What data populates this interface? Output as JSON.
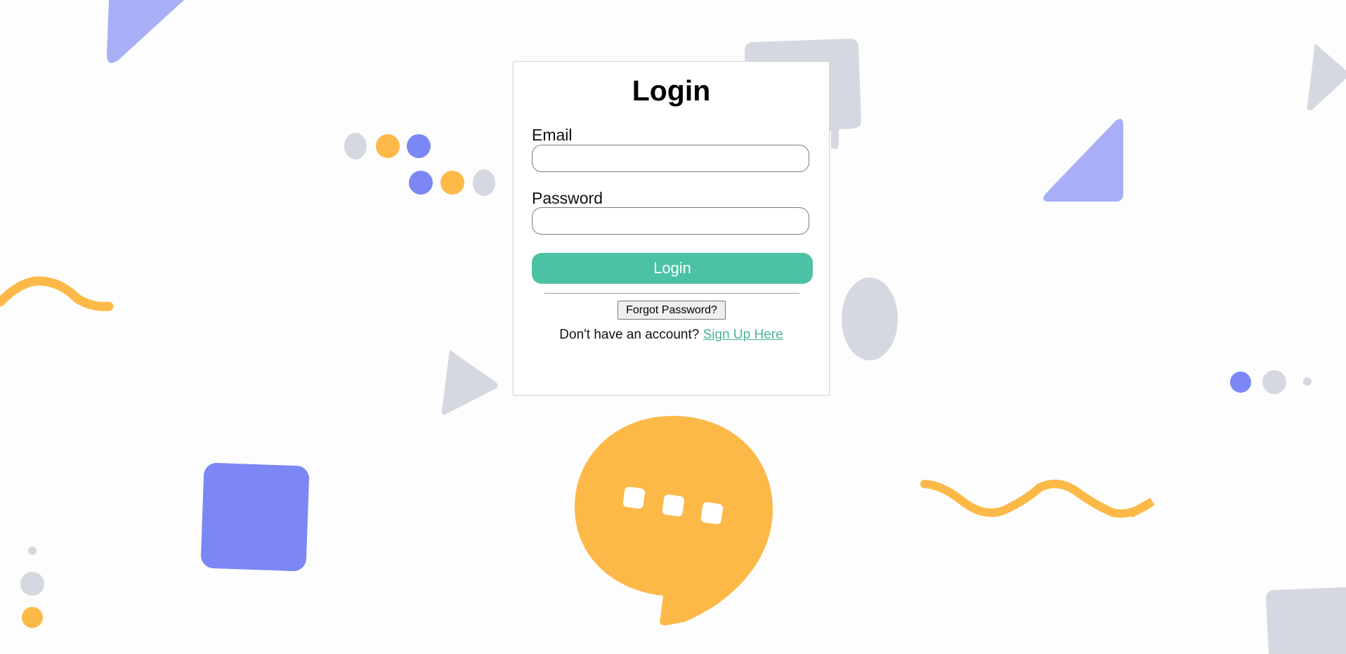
{
  "login": {
    "title": "Login",
    "email_label": "Email",
    "email_value": "",
    "password_label": "Password",
    "password_value": "",
    "submit_label": "Login",
    "forgot_label": "Forgot Password?",
    "signup_prompt": "Don't have an account?",
    "signup_link": "Sign Up Here"
  },
  "colors": {
    "accent": "#4bc2a4",
    "link": "#4bb39a",
    "decor_blue": "#7a87f5",
    "decor_light_blue": "#a8aff7",
    "decor_yellow": "#fdb948",
    "decor_gray": "#d6d8e1"
  },
  "decorations": [
    "triangle-shape",
    "rounded-square-shape",
    "dot-cluster",
    "wave-squiggle",
    "chat-bubble-icon",
    "oval-shape"
  ]
}
